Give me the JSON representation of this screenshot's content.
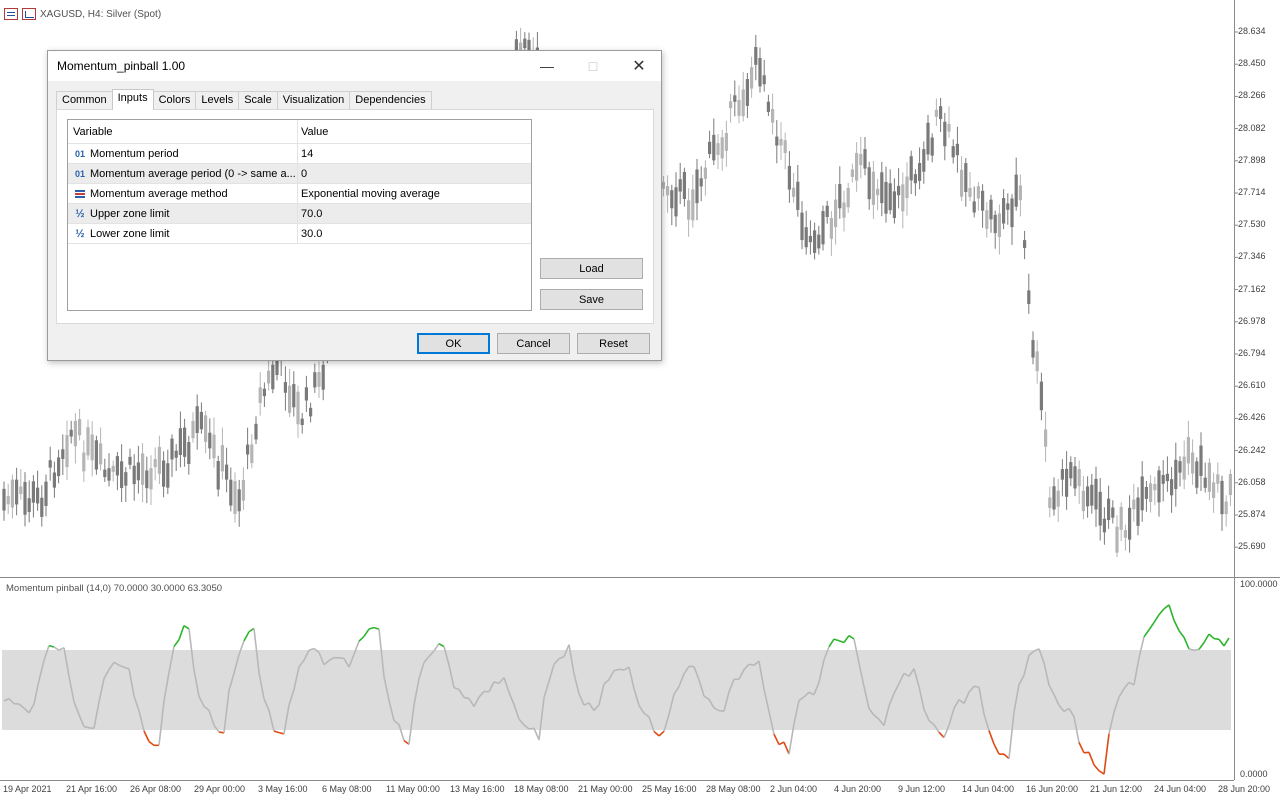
{
  "symbol": {
    "label": "XAGUSD, H4:  Silver (Spot)"
  },
  "price_axis": [
    "28.634",
    "28.450",
    "28.266",
    "28.082",
    "27.898",
    "27.714",
    "27.530",
    "27.346",
    "27.162",
    "26.978",
    "26.794",
    "26.610",
    "26.426",
    "26.242",
    "26.058",
    "25.874",
    "25.690"
  ],
  "time_axis": [
    "19 Apr 2021",
    "21 Apr 16:00",
    "26 Apr 08:00",
    "29 Apr 00:00",
    "3 May 16:00",
    "6 May 08:00",
    "11 May 00:00",
    "13 May 16:00",
    "18 May 08:00",
    "21 May 00:00",
    "25 May 16:00",
    "28 May 08:00",
    "2 Jun 04:00",
    "4 Jun 20:00",
    "9 Jun 12:00",
    "14 Jun 04:00",
    "16 Jun 20:00",
    "21 Jun 12:00",
    "24 Jun 04:00",
    "28 Jun 20:00"
  ],
  "indicator": {
    "title": "Momentum pinball (14,0) 70.0000 30.0000 63.3050",
    "axis_top": "100.0000",
    "axis_bottom": "0.0000",
    "upper": 70,
    "lower": 30
  },
  "colors": {
    "candle": "#7a7a7a",
    "candle_light": "#b5b5b5",
    "zone": "#dcdcdc",
    "line": "#b8b8b8",
    "up": "#2db52d",
    "down": "#e04a12"
  },
  "dialog": {
    "title": "Momentum_pinball 1.00",
    "tabs": [
      {
        "label": "Common"
      },
      {
        "label": "Inputs"
      },
      {
        "label": "Colors"
      },
      {
        "label": "Levels"
      },
      {
        "label": "Scale"
      },
      {
        "label": "Visualization"
      },
      {
        "label": "Dependencies"
      }
    ],
    "grid": {
      "col_variable": "Variable",
      "col_value": "Value",
      "rows": [
        {
          "icon": "integer-icon",
          "variable": "Momentum period",
          "value": "14"
        },
        {
          "icon": "integer-icon",
          "variable": "Momentum average period (0 -> same a...",
          "value": "0"
        },
        {
          "icon": "enum-icon",
          "variable": "Momentum average method",
          "value": "Exponential moving average"
        },
        {
          "icon": "double-icon",
          "variable": "Upper zone limit",
          "value": "70.0"
        },
        {
          "icon": "double-icon",
          "variable": "Lower zone limit",
          "value": "30.0"
        }
      ]
    },
    "buttons": {
      "load": "Load",
      "save": "Save",
      "ok": "OK",
      "cancel": "Cancel",
      "reset": "Reset"
    }
  }
}
